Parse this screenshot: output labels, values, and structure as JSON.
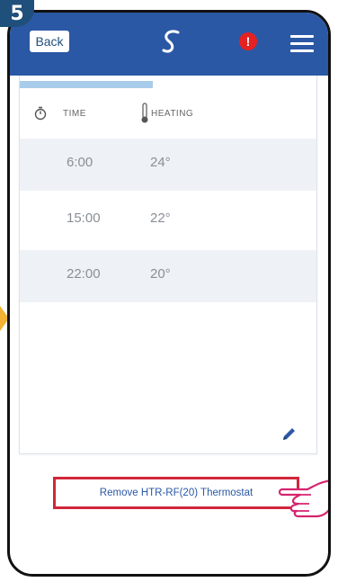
{
  "step": {
    "number": "5"
  },
  "header": {
    "back_label": "Back",
    "alert_symbol": "!",
    "logo_icon": "brand-logo-icon",
    "menu_icon": "hamburger-icon"
  },
  "schedule": {
    "columns": {
      "time": "TIME",
      "heating": "HEATING"
    },
    "rows": [
      {
        "time": "6:00",
        "temp": "24°"
      },
      {
        "time": "15:00",
        "temp": "22°"
      },
      {
        "time": "22:00",
        "temp": "20°"
      }
    ]
  },
  "actions": {
    "remove_label": "Remove HTR-RF(20) Thermostat"
  },
  "colors": {
    "topbar": "#2b58a5",
    "highlight": "#d0263a",
    "alert": "#e52121",
    "hand": "#d6246e",
    "marker": "#f2b233"
  }
}
